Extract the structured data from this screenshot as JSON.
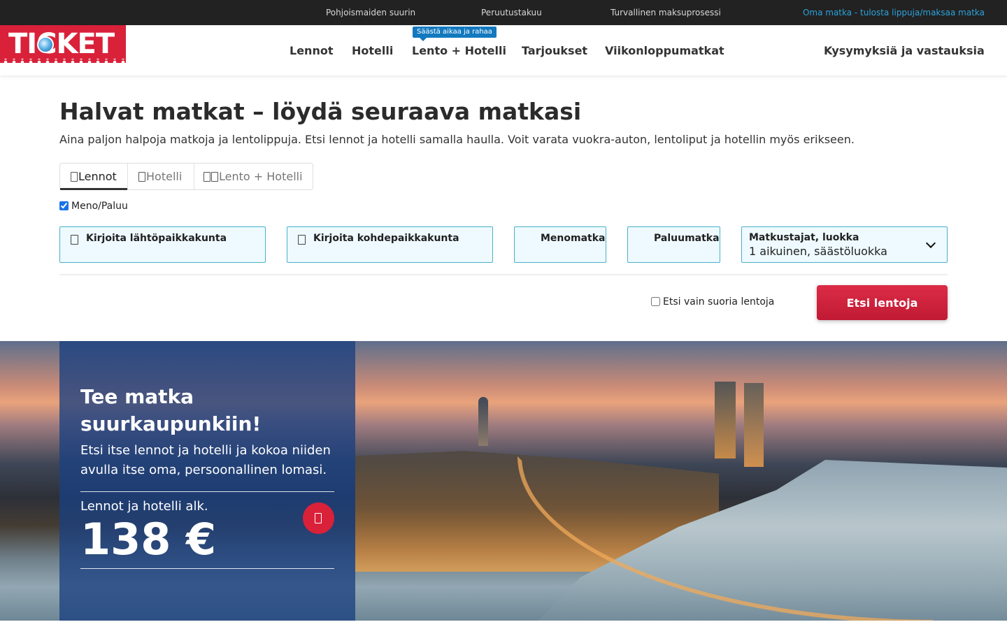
{
  "topbar": {
    "item1": "Pohjoismaiden suurin",
    "item2": "Peruutustakuu",
    "item3": "Turvallinen maksuprosessi",
    "my_trip_link": "Oma matka - tulosta lippuja/maksaa matka"
  },
  "header": {
    "logo": "TICKET",
    "nav": {
      "flights": "Lennot",
      "hotel": "Hotelli",
      "flight_hotel": "Lento + Hotelli",
      "flight_hotel_badge": "Säästä aikaa ja rahaa",
      "offers": "Tarjoukset",
      "weekend": "Viikonloppumatkat",
      "faq": "Kysymyksiä ja vastauksia"
    }
  },
  "page": {
    "title": "Halvat matkat – löydä seuraava matkasi",
    "intro": "Aina paljon halpoja matkoja ja lentolippuja. Etsi lennot ja hotelli samalla haulla. Voit varata vuokra-auton, lentoliput ja hotellin myös erikseen."
  },
  "search": {
    "tabs": {
      "flights": "Lennot",
      "hotel": "Hotelli",
      "flight_hotel": "Lento + Hotelli"
    },
    "roundtrip_label": "Meno/Paluu",
    "roundtrip_checked": true,
    "from_label": "Kirjoita lähtöpaikkakunta",
    "to_label": "Kirjoita kohdepaikkakunta",
    "departure_label": "Menomatka",
    "return_label": "Paluumatka",
    "passengers_label": "Matkustajat, luokka",
    "passengers_value": "1 aikuinen, säästöluokka",
    "direct_only_label": "Etsi vain suoria lentoja",
    "direct_only_checked": false,
    "submit_label": "Etsi lentoja"
  },
  "promo": {
    "title": "Tee matka suurkaupunkiin!",
    "text": "Etsi itse lennot ja hotelli ja kokoa niiden avulla itse oma, persoonallinen lomasi.",
    "price_prefix": "Lennot ja hotelli alk.",
    "price": "138 €"
  },
  "colors": {
    "brand_red": "#d9213a",
    "topbar_bg": "#222222",
    "link_blue": "#2aa3dd",
    "field_border": "#4ab0c8",
    "field_bg": "#eefaff",
    "promo_panel": "#1b4080"
  },
  "icons": {
    "tab_flights": "plane-icon",
    "tab_hotel": "bed-icon",
    "tab_flight_hotel": "plane-bed-icon",
    "from_field": "plane-takeoff-icon",
    "to_field": "plane-landing-icon",
    "passengers_dropdown": "chevron-down-icon",
    "promo_cta": "arrow-right-icon"
  }
}
